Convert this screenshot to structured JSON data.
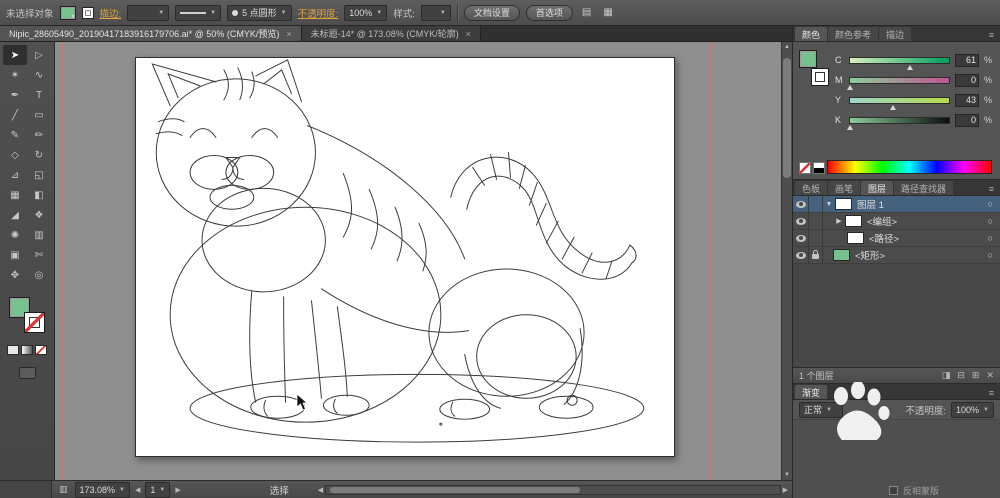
{
  "icons": {
    "dropdown": "▼",
    "up": "▲",
    "down": "▼",
    "left": "◀",
    "right": "▶",
    "close": "×",
    "menu": "≡",
    "triangle_open": "▼",
    "triangle_closed": "▶",
    "target": "○"
  },
  "control_bar": {
    "selection_status": "未选择对象",
    "fill_color": "#76c28f",
    "stroke_label": "描边:",
    "brush_name": "5 点圆形",
    "opacity_label": "不透明度:",
    "opacity_value": "100%",
    "style_label": "样式:",
    "document_setup": "文档设置",
    "preferences": "首选项",
    "icon_1": "▤",
    "icon_2": "▦"
  },
  "document_tabs": [
    {
      "title": "Nipic_28605490_20190417183916179706.ai* @ 50% (CMYK/预览)"
    },
    {
      "title": "未标题-14* @ 173.08% (CMYK/轮廓)"
    }
  ],
  "toolbar": {
    "tools": [
      {
        "name": "selection",
        "glyph": "➤"
      },
      {
        "name": "direct-selection",
        "glyph": "▷"
      },
      {
        "name": "magic-wand",
        "glyph": "✶"
      },
      {
        "name": "lasso",
        "glyph": "∿"
      },
      {
        "name": "pen",
        "glyph": "✒"
      },
      {
        "name": "type",
        "glyph": "T"
      },
      {
        "name": "line-segment",
        "glyph": "╱"
      },
      {
        "name": "rectangle",
        "glyph": "▭"
      },
      {
        "name": "paintbrush",
        "glyph": "✎"
      },
      {
        "name": "pencil",
        "glyph": "✏"
      },
      {
        "name": "width",
        "glyph": "◇"
      },
      {
        "name": "rotate",
        "glyph": "↻"
      },
      {
        "name": "scale",
        "glyph": "⊿"
      },
      {
        "name": "shape-builder",
        "glyph": "◱"
      },
      {
        "name": "mesh",
        "glyph": "▦"
      },
      {
        "name": "gradient",
        "glyph": "◧"
      },
      {
        "name": "eyedropper",
        "glyph": "◢"
      },
      {
        "name": "blend",
        "glyph": "❖"
      },
      {
        "name": "symbol-sprayer",
        "glyph": "✺"
      },
      {
        "name": "column-graph",
        "glyph": "▥"
      },
      {
        "name": "artboard",
        "glyph": "▣"
      },
      {
        "name": "slice",
        "glyph": "✄"
      },
      {
        "name": "hand",
        "glyph": "✥"
      },
      {
        "name": "zoom",
        "glyph": "◎"
      }
    ]
  },
  "color_panel": {
    "tabs": [
      "颜色",
      "颜色参考",
      "描边"
    ],
    "channels": [
      {
        "label": "C",
        "value": "61",
        "percent": 61
      },
      {
        "label": "M",
        "value": "0",
        "percent": 0
      },
      {
        "label": "Y",
        "value": "43",
        "percent": 43
      },
      {
        "label": "K",
        "value": "0",
        "percent": 0
      }
    ],
    "unit": "%"
  },
  "layers_panel": {
    "tabs": [
      "色板",
      "画笔",
      "图层",
      "路径查找器"
    ],
    "rows": [
      {
        "name": "图层 1"
      },
      {
        "name": "<编组>"
      },
      {
        "name": "<路径>"
      },
      {
        "name": "<矩形>"
      }
    ],
    "footer": "1 个图层"
  },
  "transparency_panel": {
    "gradient_tab": "渐变",
    "blend_mode": "正常",
    "opacity_label": "不透明度:",
    "opacity_value": "100%",
    "invert_mask_label": "反相蒙版"
  },
  "status_bar": {
    "zoom": "173.08%",
    "nav_value": "1",
    "tool_status": "选择"
  }
}
